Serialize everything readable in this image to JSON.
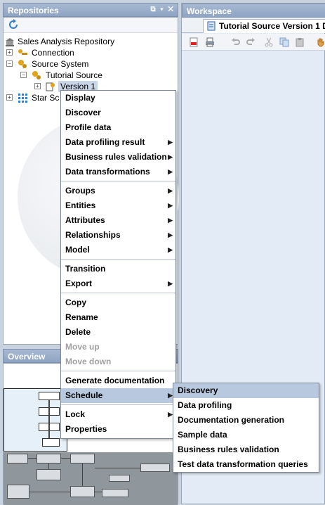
{
  "repositories": {
    "title": "Repositories",
    "controls": "⧉ ▾ ✕",
    "tree": [
      {
        "label": "Sales Analysis Repository"
      },
      {
        "label": "Connection"
      },
      {
        "label": "Source System"
      },
      {
        "label": "Tutorial Source"
      },
      {
        "label": "Version 1"
      },
      {
        "label": "Star Sc"
      }
    ]
  },
  "workspace": {
    "title": "Workspace",
    "tab_label": "Tutorial Source Version 1 D"
  },
  "overview": {
    "title": "Overview"
  },
  "context_menu": {
    "groups": [
      [
        {
          "label": "Display",
          "submenu": false,
          "disabled": false
        },
        {
          "label": "Discover",
          "submenu": false,
          "disabled": false
        },
        {
          "label": "Profile data",
          "submenu": false,
          "disabled": false
        },
        {
          "label": "Data profiling result",
          "submenu": true,
          "disabled": false
        },
        {
          "label": "Business rules validation",
          "submenu": true,
          "disabled": false
        },
        {
          "label": "Data transformations",
          "submenu": true,
          "disabled": false
        }
      ],
      [
        {
          "label": "Groups",
          "submenu": true,
          "disabled": false
        },
        {
          "label": "Entities",
          "submenu": true,
          "disabled": false
        },
        {
          "label": "Attributes",
          "submenu": true,
          "disabled": false
        },
        {
          "label": "Relationships",
          "submenu": true,
          "disabled": false
        },
        {
          "label": "Model",
          "submenu": true,
          "disabled": false
        }
      ],
      [
        {
          "label": "Transition",
          "submenu": false,
          "disabled": false
        },
        {
          "label": "Export",
          "submenu": true,
          "disabled": false
        }
      ],
      [
        {
          "label": "Copy",
          "submenu": false,
          "disabled": false
        },
        {
          "label": "Rename",
          "submenu": false,
          "disabled": false
        },
        {
          "label": "Delete",
          "submenu": false,
          "disabled": false
        },
        {
          "label": "Move up",
          "submenu": false,
          "disabled": true
        },
        {
          "label": "Move down",
          "submenu": false,
          "disabled": true
        }
      ],
      [
        {
          "label": "Generate documentation",
          "submenu": false,
          "disabled": false
        },
        {
          "label": "Schedule",
          "submenu": true,
          "disabled": false,
          "highlighted": true
        }
      ],
      [
        {
          "label": "Lock",
          "submenu": true,
          "disabled": false
        },
        {
          "label": "Properties",
          "submenu": false,
          "disabled": false
        }
      ]
    ]
  },
  "schedule_submenu": {
    "items": [
      {
        "label": "Discovery",
        "highlighted": true
      },
      {
        "label": "Data profiling"
      },
      {
        "label": "Documentation generation"
      },
      {
        "label": "Sample data"
      },
      {
        "label": "Business rules validation"
      },
      {
        "label": "Test data transformation queries"
      }
    ]
  },
  "colors": {
    "highlight": "#b8c8de",
    "title_bar": "#8ea4c4",
    "workspace_bg": "#e3ecf6"
  }
}
